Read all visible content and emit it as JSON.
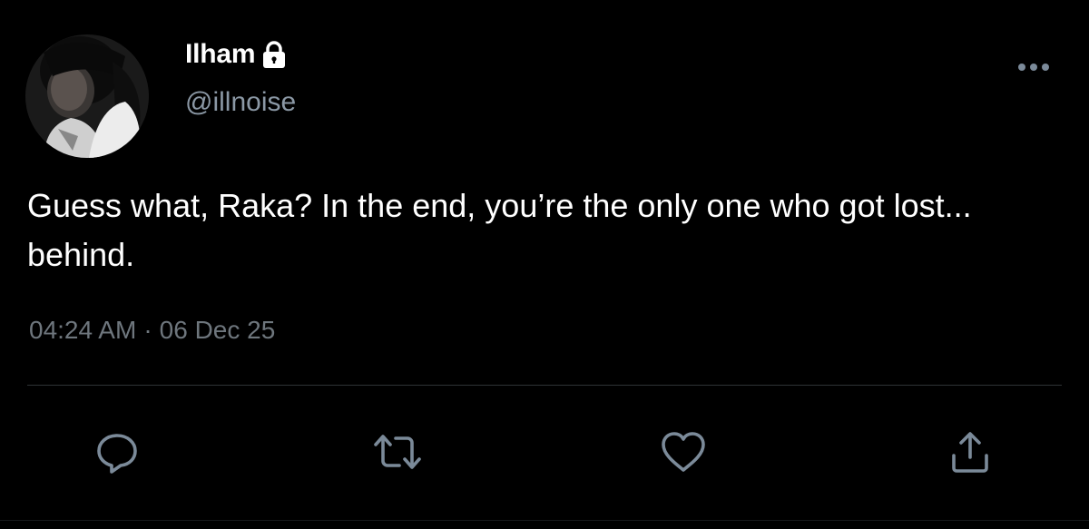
{
  "user": {
    "display_name": "Ilham",
    "handle": "@illnoise",
    "protected_icon": "lock-icon",
    "avatar": "profile-photo"
  },
  "tweet": {
    "text": "Guess what, Raka? In the end, you’re the only one who got lost... behind.",
    "time": "04:24 AM",
    "separator": "·",
    "date": "06 Dec 25"
  },
  "actions": [
    {
      "name": "reply",
      "icon": "comment-icon"
    },
    {
      "name": "retweet",
      "icon": "retweet-icon"
    },
    {
      "name": "like",
      "icon": "heart-icon"
    },
    {
      "name": "share",
      "icon": "share-icon"
    }
  ],
  "menu": {
    "icon": "more-options-icon"
  },
  "colors": {
    "background": "#000000",
    "text": "#ffffff",
    "secondary_text": "#8b98a5",
    "icon": "#7b8a99",
    "divider": "#2f3336"
  }
}
